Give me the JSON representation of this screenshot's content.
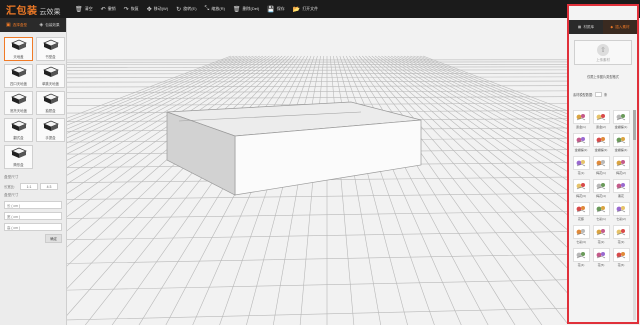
{
  "app": {
    "brand": "汇包装",
    "sub": "云效果"
  },
  "toolbar": [
    {
      "icon": "trash-icon",
      "glyph": "🗑",
      "label": "清空"
    },
    {
      "icon": "undo-icon",
      "glyph": "↶",
      "label": "撤销"
    },
    {
      "icon": "redo-icon",
      "glyph": "↷",
      "label": "恢复"
    },
    {
      "icon": "move-icon",
      "glyph": "✥",
      "label": "移动(W)"
    },
    {
      "icon": "rotate-icon",
      "glyph": "↻",
      "label": "旋转(E)"
    },
    {
      "icon": "scale-icon",
      "glyph": "⤡",
      "label": "缩放(R)"
    },
    {
      "icon": "delete-icon",
      "glyph": "🗑",
      "label": "删除(Del)"
    },
    {
      "icon": "save-icon",
      "glyph": "💾",
      "label": "保存"
    },
    {
      "icon": "open-file-icon",
      "glyph": "📂",
      "label": "打开文件"
    }
  ],
  "left": {
    "tabs": [
      "选择盒型",
      "包装效果"
    ],
    "boxes": [
      "天地盖",
      "书型盒",
      "四口天地盖",
      "单跳天地盖",
      "底托天地盖",
      "抽屉盒",
      "翻式盒",
      "手提盒",
      "筒形盒"
    ],
    "params": {
      "title": "盒型尺寸",
      "ratio_label": "长宽比:",
      "ratio_a": "1:1",
      "ratio_b": "4:3",
      "size_title": "盒型尺寸",
      "length": "长 ( cm )",
      "width": "宽 ( cm )",
      "height": "高 ( cm )",
      "confirm": "确定"
    }
  },
  "right": {
    "tabs": [
      "材质库",
      "插入素材"
    ],
    "upload_label": "上传素材",
    "hint": "仅限上传图片类型格式",
    "filter_label": "素材模型数据:",
    "filter_unit": "条",
    "materials": [
      "贵金(1)",
      "贵金(2)",
      "金蝴蝶(1)",
      "金蝴蝶(2)",
      "金蝴蝶(3)",
      "金蝴蝶(4)",
      "花(1)",
      "梅花(1)",
      "梅花(2)",
      "梅花(3)",
      "梅花(4)",
      "黑花",
      "花藤",
      "七彩(1)",
      "七彩(2)",
      "七彩(3)",
      "花(2)",
      "花(3)",
      "花(4)",
      "花(5)",
      "花(6)"
    ]
  },
  "colors": {
    "accent": "#f07a26",
    "highlight": "#e0303a"
  }
}
